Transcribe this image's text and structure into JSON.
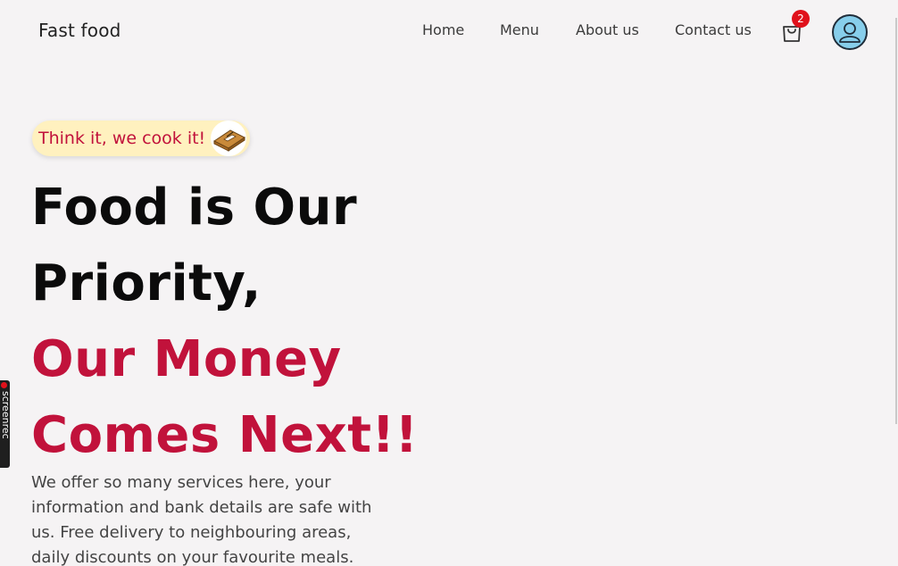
{
  "navbar": {
    "brand": "Fast food",
    "links": [
      "Home",
      "Menu",
      "About us",
      "Contact us"
    ],
    "cart_count": "2"
  },
  "hero": {
    "tagline": "Think it, we cook it!",
    "headline_lines": [
      "Food is Our",
      "Priority,",
      "Our Money",
      "Comes Next!!"
    ],
    "description": "We offer so many services here, your information and bank details are safe with us. Free delivery to neighbouring areas, daily discounts on your favourite meals."
  },
  "screenrec": {
    "label": "screenrec"
  },
  "colors": {
    "accent": "#c1123b",
    "background": "#f5f3f4",
    "badge": "#e0111b",
    "avatar": "#87ceeb"
  },
  "icons": {
    "cart": "shopping-bag-icon",
    "avatar": "user-icon",
    "tagline": "sandwich-icon"
  }
}
